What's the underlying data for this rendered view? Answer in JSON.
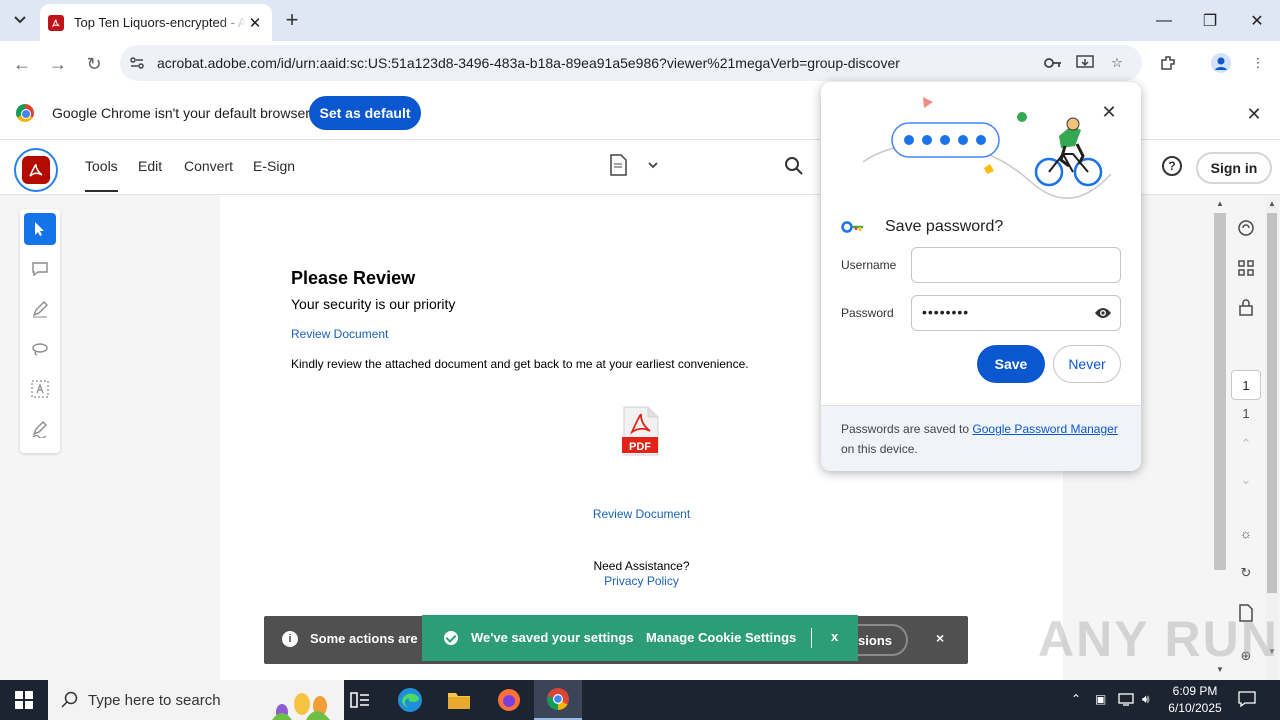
{
  "browser": {
    "tab_title": "Top Ten Liquors-encrypted - Ad",
    "url": "acrobat.adobe.com/id/urn:aaid:sc:US:51a123d8-3496-483a-b18a-89ea91a5e986?viewer%21megaVerb=group-discover"
  },
  "infobar": {
    "message": "Google Chrome isn't your default browser",
    "button": "Set as default"
  },
  "acrobat": {
    "tabs": [
      "Tools",
      "Edit",
      "Convert",
      "E-Sign"
    ],
    "sign_in": "Sign in",
    "help": "?"
  },
  "document": {
    "title": "Please Review",
    "subtitle": "Your security is our priority",
    "link_top": "Review Document",
    "body": "Kindly review the attached document and get back to me at your earliest convenience.",
    "pdf_label": "PDF",
    "link_bottom": "Review Document",
    "need_assistance": "Need Assistance?",
    "privacy": "Privacy Policy"
  },
  "page_nav": {
    "current": "1",
    "total": "1"
  },
  "cookie_bar": {
    "text": "Some actions are re",
    "button_fragment": "ssions",
    "close": "×"
  },
  "toast": {
    "text": "We've saved your settings",
    "manage": "Manage Cookie Settings",
    "close": "x"
  },
  "password_popup": {
    "title": "Save password?",
    "username_label": "Username",
    "username_value": "",
    "password_label": "Password",
    "password_masked": "••••••••",
    "save": "Save",
    "never": "Never",
    "footer_prefix": "Passwords are saved to ",
    "footer_link": "Google Password Manager",
    "footer_suffix": " on this device."
  },
  "watermark": "ANY RUN",
  "taskbar": {
    "search_placeholder": "Type here to search",
    "time": "6:09 PM",
    "date": "6/10/2025"
  },
  "colors": {
    "chrome_blue": "#0b57d0",
    "acrobat_red": "#b30b00",
    "toast_green": "#2d9d78",
    "cookie_grey": "#505050"
  }
}
